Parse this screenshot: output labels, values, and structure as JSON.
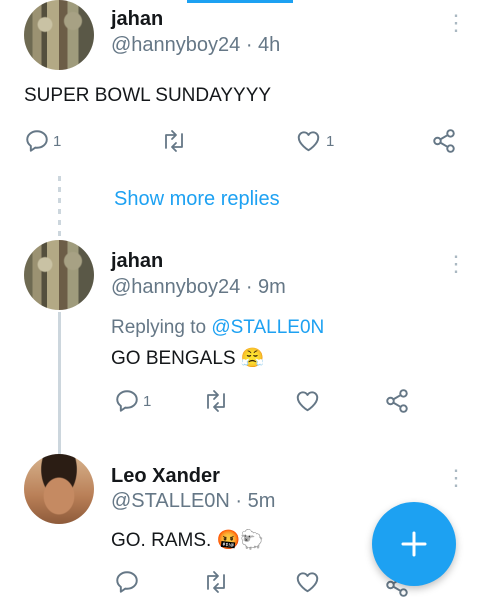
{
  "tweets": [
    {
      "name": "jahan",
      "handle": "@hannyboy24 · 4h",
      "text": "SUPER BOWL SUNDAYYYY",
      "reply_count": "1",
      "like_count": "1"
    },
    {
      "name": "jahan",
      "handle": "@hannyboy24 · 9m",
      "replying_prefix": "Replying to ",
      "replying_to": "@STALLE0N",
      "text": "GO BENGALS 😤",
      "reply_count": "1"
    },
    {
      "name": "Leo Xander",
      "handle": "@STALLE0N · 5m",
      "text": "GO. RAMS. 🤬🐑"
    }
  ],
  "show_more_replies": "Show more replies",
  "colors": {
    "accent": "#1da1f2",
    "muted": "#657786",
    "icon": "#657786"
  },
  "icons": [
    "reply-icon",
    "retweet-icon",
    "like-icon",
    "share-icon",
    "more-icon",
    "compose-icon"
  ]
}
